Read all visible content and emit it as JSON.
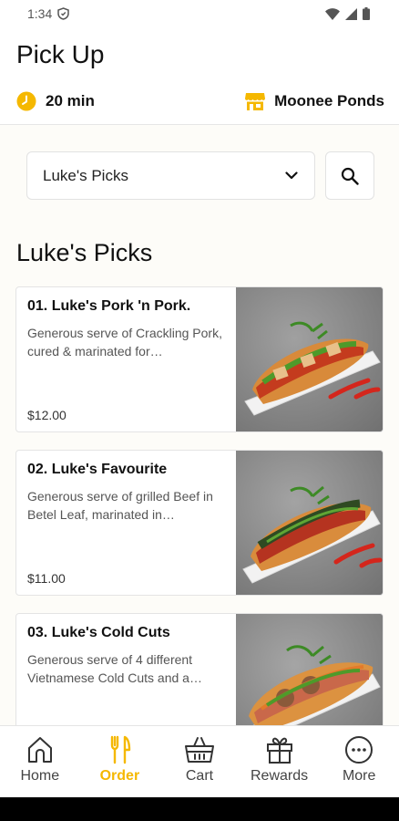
{
  "status": {
    "time": "1:34"
  },
  "header": {
    "title": "Pick Up",
    "pickup_time": "20 min",
    "store": "Moonee Ponds"
  },
  "category_select": {
    "value": "Luke's Picks"
  },
  "section": {
    "title": "Luke's Picks"
  },
  "products": [
    {
      "name": "01. Luke's Pork 'n Pork.",
      "description": "Generous serve of Crackling Pork, cured & marinated for…",
      "price": "$12.00"
    },
    {
      "name": "02. Luke's Favourite",
      "description": "Generous serve of grilled Beef in Betel Leaf, marinated in…",
      "price": "$11.00"
    },
    {
      "name": "03. Luke's Cold Cuts",
      "description": "Generous serve of 4 different Vietnamese Cold Cuts and a…",
      "price": ""
    }
  ],
  "nav": {
    "home": "Home",
    "order": "Order",
    "cart": "Cart",
    "rewards": "Rewards",
    "more": "More"
  },
  "colors": {
    "accent": "#f5b800",
    "background": "#fdfcf8"
  },
  "icons": {
    "status": [
      "shield-icon",
      "wifi-icon",
      "signal-icon",
      "battery-icon"
    ],
    "header": [
      "clock-icon",
      "store-icon"
    ],
    "nav": [
      "home-icon",
      "cutlery-icon",
      "basket-icon",
      "gift-icon",
      "more-icon"
    ]
  }
}
